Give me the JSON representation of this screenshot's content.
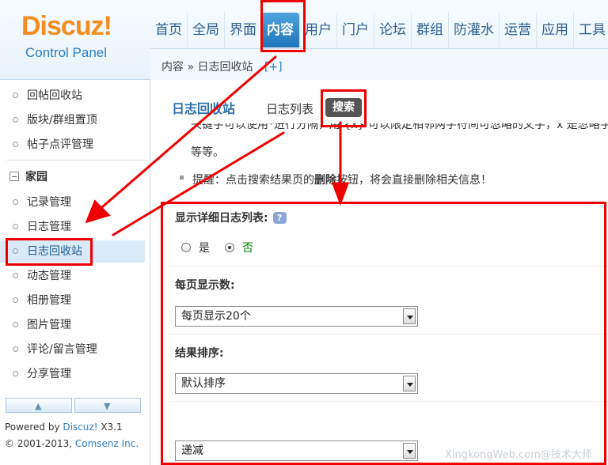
{
  "logo": {
    "title": "Discuz!",
    "subtitle": "Control Panel"
  },
  "topnav": [
    "首页",
    "全局",
    "界面",
    "内容",
    "用户",
    "门户",
    "论坛",
    "群组",
    "防灌水",
    "运营",
    "应用",
    "工具"
  ],
  "topnav_active": "内容",
  "breadcrumb": {
    "path": "内容 » 日志回收站",
    "add": "[+]"
  },
  "sidebar": {
    "items_top": [
      "回帖回收站",
      "版块/群组置顶",
      "帖子点评管理"
    ],
    "section": "家园",
    "items_home": [
      "记录管理",
      "日志管理",
      "日志回收站",
      "动态管理",
      "相册管理",
      "图片管理",
      "评论/留言管理",
      "分享管理"
    ],
    "active": "日志回收站",
    "scroll_up": "▲",
    "scroll_down": "▼",
    "powered_prefix": "Powered by ",
    "powered_brand": "Discuz!",
    "powered_version": " X3.1",
    "copyright_prefix": "© 2001-2013, ",
    "copyright_brand": "Comsenz Inc."
  },
  "main": {
    "title": "日志回收站",
    "tab_list": "日志列表",
    "tab_search": "搜索",
    "tip_line1": "关键字可以使用*进行分隔，用 {x} 可以限定相邻两字符间可忽略的文字，x 是忽略字符的个数",
    "tip_line2": "等等。",
    "tip_prefix": "提醒：点击搜索结果页的",
    "tip_bold": "删除",
    "tip_suffix": "按钮，将会直接删除相关信息！",
    "detail_label": "显示详细日志列表:",
    "help_icon": "?",
    "radio_yes": "是",
    "radio_no": "否",
    "perpage_label": "每页显示数:",
    "perpage_value": "每页显示20个",
    "sort_label": "结果排序:",
    "sort_value": "默认排序",
    "order_value": "递减"
  },
  "watermark": "XingkongWeb.com@技术大师",
  "colors": {
    "accent": "#2c71b0",
    "logo_orange": "#f58d1e",
    "annotation_red": "#e00000",
    "radio_green": "#008000"
  }
}
